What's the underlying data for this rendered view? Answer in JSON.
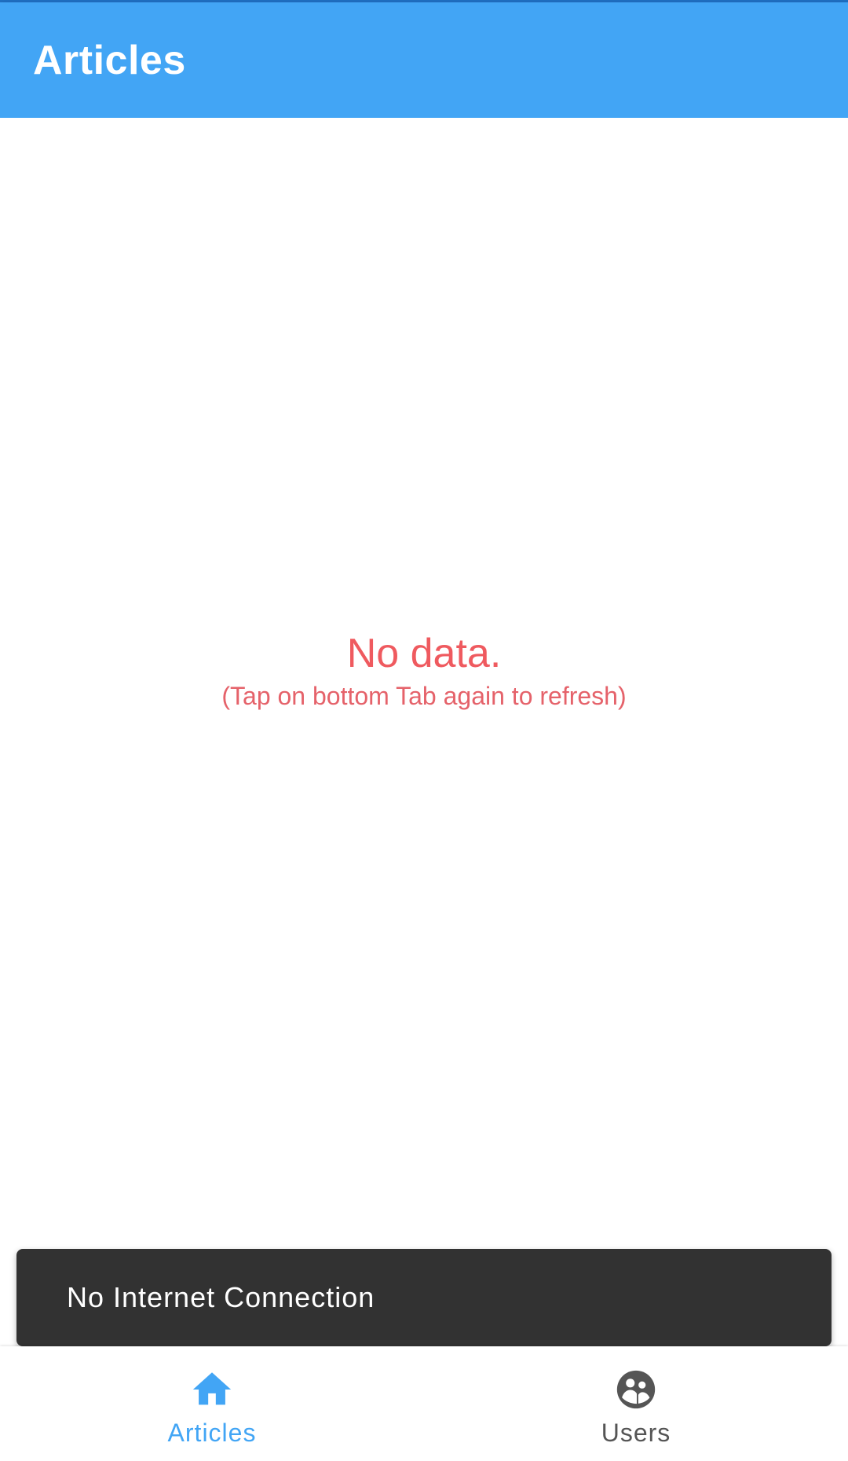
{
  "app_bar": {
    "title": "Articles",
    "color": "#42a5f5"
  },
  "empty_state": {
    "title": "No data.",
    "subtitle": "(Tap on bottom Tab again to refresh)",
    "color": "#ef5a5f"
  },
  "snackbar": {
    "message": "No Internet Connection"
  },
  "bottom_nav": {
    "items": [
      {
        "label": "Articles",
        "icon": "home-icon",
        "active": true
      },
      {
        "label": "Users",
        "icon": "users-icon",
        "active": false
      }
    ]
  }
}
